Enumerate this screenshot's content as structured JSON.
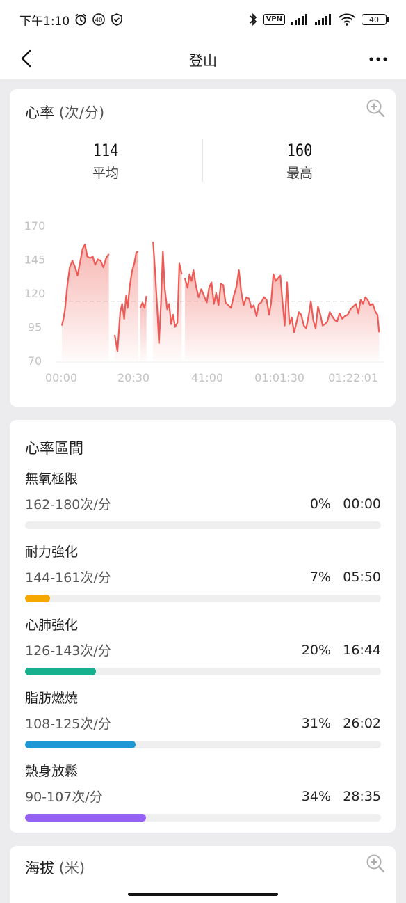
{
  "status_bar": {
    "time": "下午1:10",
    "notif_badge": "40",
    "vpn": "VPN",
    "battery": "40"
  },
  "nav": {
    "title": "登山"
  },
  "heart_rate": {
    "title": "心率",
    "unit": "(次/分)",
    "avg_value": "114",
    "avg_label": "平均",
    "max_value": "160",
    "max_label": "最高"
  },
  "chart_data": {
    "type": "area",
    "color": "#ee5a55",
    "y_ticks": [
      "170",
      "145",
      "120",
      "95",
      "70"
    ],
    "x_ticks": [
      "00:00",
      "20:30",
      "41:00",
      "01:01:30",
      "01:22:01"
    ],
    "ylim": [
      70,
      170
    ],
    "xlim": [
      0,
      82.02
    ],
    "average_line": 114,
    "average_line_style": "dashed",
    "x_unit": "minutes",
    "segments": [
      [
        [
          0,
          96
        ],
        [
          0.4,
          101
        ],
        [
          0.8,
          108
        ],
        [
          1.4,
          126
        ],
        [
          2.0,
          139
        ],
        [
          2.7,
          144
        ],
        [
          3.4,
          139
        ],
        [
          4.0,
          133
        ],
        [
          4.6,
          142
        ],
        [
          5.3,
          153
        ],
        [
          5.9,
          156
        ],
        [
          6.5,
          147
        ],
        [
          7.2,
          146
        ],
        [
          7.9,
          147
        ],
        [
          8.5,
          141
        ],
        [
          9.2,
          145
        ],
        [
          9.9,
          144
        ],
        [
          10.6,
          139
        ],
        [
          11.3,
          146
        ],
        [
          12.0,
          149
        ]
      ],
      [
        [
          13.5,
          89
        ],
        [
          13.9,
          82
        ],
        [
          14.2,
          77
        ],
        [
          14.6,
          93
        ],
        [
          14.9,
          106
        ],
        [
          15.4,
          112
        ],
        [
          15.9,
          101
        ],
        [
          16.4,
          118
        ],
        [
          16.8,
          109
        ],
        [
          17.3,
          124
        ],
        [
          17.9,
          136
        ],
        [
          18.5,
          142
        ],
        [
          19.0,
          150
        ],
        [
          19.5,
          151
        ]
      ],
      [
        [
          20.0,
          109
        ],
        [
          20.6,
          113
        ],
        [
          21.1,
          109
        ],
        [
          21.6,
          118
        ]
      ],
      [
        [
          23.3,
          158
        ],
        [
          23.8,
          136
        ],
        [
          24.3,
          111
        ],
        [
          24.8,
          83
        ],
        [
          25.3,
          112
        ],
        [
          25.8,
          151
        ],
        [
          26.3,
          123
        ],
        [
          26.9,
          108
        ],
        [
          27.4,
          112
        ],
        [
          27.9,
          97
        ],
        [
          28.4,
          104
        ],
        [
          28.9,
          95
        ],
        [
          29.5,
          98
        ],
        [
          30.0,
          142
        ],
        [
          30.6,
          134
        ]
      ],
      [
        [
          31.4,
          131
        ],
        [
          32.1,
          124
        ],
        [
          32.6,
          134
        ],
        [
          33.1,
          129
        ],
        [
          33.6,
          137
        ],
        [
          34.2,
          126
        ],
        [
          34.9,
          117
        ],
        [
          35.6,
          123
        ],
        [
          36.3,
          118
        ],
        [
          37.0,
          113
        ],
        [
          37.6,
          124
        ],
        [
          38.2,
          128
        ],
        [
          38.8,
          112
        ],
        [
          39.4,
          120
        ],
        [
          40.0,
          111
        ],
        [
          40.6,
          127
        ],
        [
          41.2,
          126
        ],
        [
          41.8,
          113
        ],
        [
          42.5,
          111
        ],
        [
          43.2,
          109
        ],
        [
          43.9,
          118
        ],
        [
          44.6,
          125
        ],
        [
          45.2,
          137
        ],
        [
          45.8,
          121
        ],
        [
          46.4,
          111
        ],
        [
          47.1,
          117
        ],
        [
          47.8,
          116
        ],
        [
          48.4,
          109
        ],
        [
          49.0,
          111
        ],
        [
          49.7,
          103
        ],
        [
          50.3,
          112
        ],
        [
          50.9,
          113
        ],
        [
          51.6,
          117
        ],
        [
          52.3,
          115
        ],
        [
          52.9,
          104
        ],
        [
          53.4,
          112
        ],
        [
          54.0,
          134
        ],
        [
          54.6,
          129
        ],
        [
          55.2,
          131
        ],
        [
          55.8,
          133
        ],
        [
          56.3,
          115
        ],
        [
          56.9,
          96
        ],
        [
          57.5,
          128
        ],
        [
          58.1,
          97
        ],
        [
          58.7,
          102
        ],
        [
          59.3,
          91
        ],
        [
          59.9,
          98
        ],
        [
          60.5,
          106
        ],
        [
          61.1,
          104
        ],
        [
          61.8,
          96
        ],
        [
          62.4,
          94
        ],
        [
          63.0,
          103
        ],
        [
          63.6,
          114
        ],
        [
          64.2,
          100
        ],
        [
          64.8,
          94
        ],
        [
          65.4,
          110
        ],
        [
          66.0,
          104
        ],
        [
          66.6,
          96
        ],
        [
          67.2,
          97
        ],
        [
          67.8,
          99
        ],
        [
          68.4,
          106
        ],
        [
          69.0,
          103
        ],
        [
          69.7,
          100
        ],
        [
          70.3,
          99
        ],
        [
          70.9,
          105
        ],
        [
          71.6,
          101
        ],
        [
          72.3,
          103
        ],
        [
          73.0,
          104
        ],
        [
          73.7,
          108
        ],
        [
          74.4,
          110
        ],
        [
          75.1,
          112
        ],
        [
          75.7,
          105
        ],
        [
          76.3,
          115
        ],
        [
          76.9,
          112
        ],
        [
          77.5,
          117
        ],
        [
          78.1,
          115
        ],
        [
          78.7,
          111
        ],
        [
          79.4,
          112
        ],
        [
          80.1,
          106
        ],
        [
          80.6,
          104
        ],
        [
          81.0,
          91
        ]
      ]
    ]
  },
  "zones": {
    "title": "心率區間",
    "items": [
      {
        "name": "無氧極限",
        "range": "162-180次/分",
        "pct": "0%",
        "time": "00:00",
        "fraction": 0.0,
        "color": "#e8e8e8"
      },
      {
        "name": "耐力強化",
        "range": "144-161次/分",
        "pct": "7%",
        "time": "05:50",
        "fraction": 0.07,
        "color": "#f5a800"
      },
      {
        "name": "心肺強化",
        "range": "126-143次/分",
        "pct": "20%",
        "time": "16:44",
        "fraction": 0.2,
        "color": "#17b08e"
      },
      {
        "name": "脂肪燃燒",
        "range": "108-125次/分",
        "pct": "31%",
        "time": "26:02",
        "fraction": 0.31,
        "color": "#1e98d5"
      },
      {
        "name": "熱身放鬆",
        "range": "90-107次/分",
        "pct": "34%",
        "time": "28:35",
        "fraction": 0.34,
        "color": "#9560f5"
      }
    ]
  },
  "altitude": {
    "title": "海拔",
    "unit": "(米)"
  }
}
